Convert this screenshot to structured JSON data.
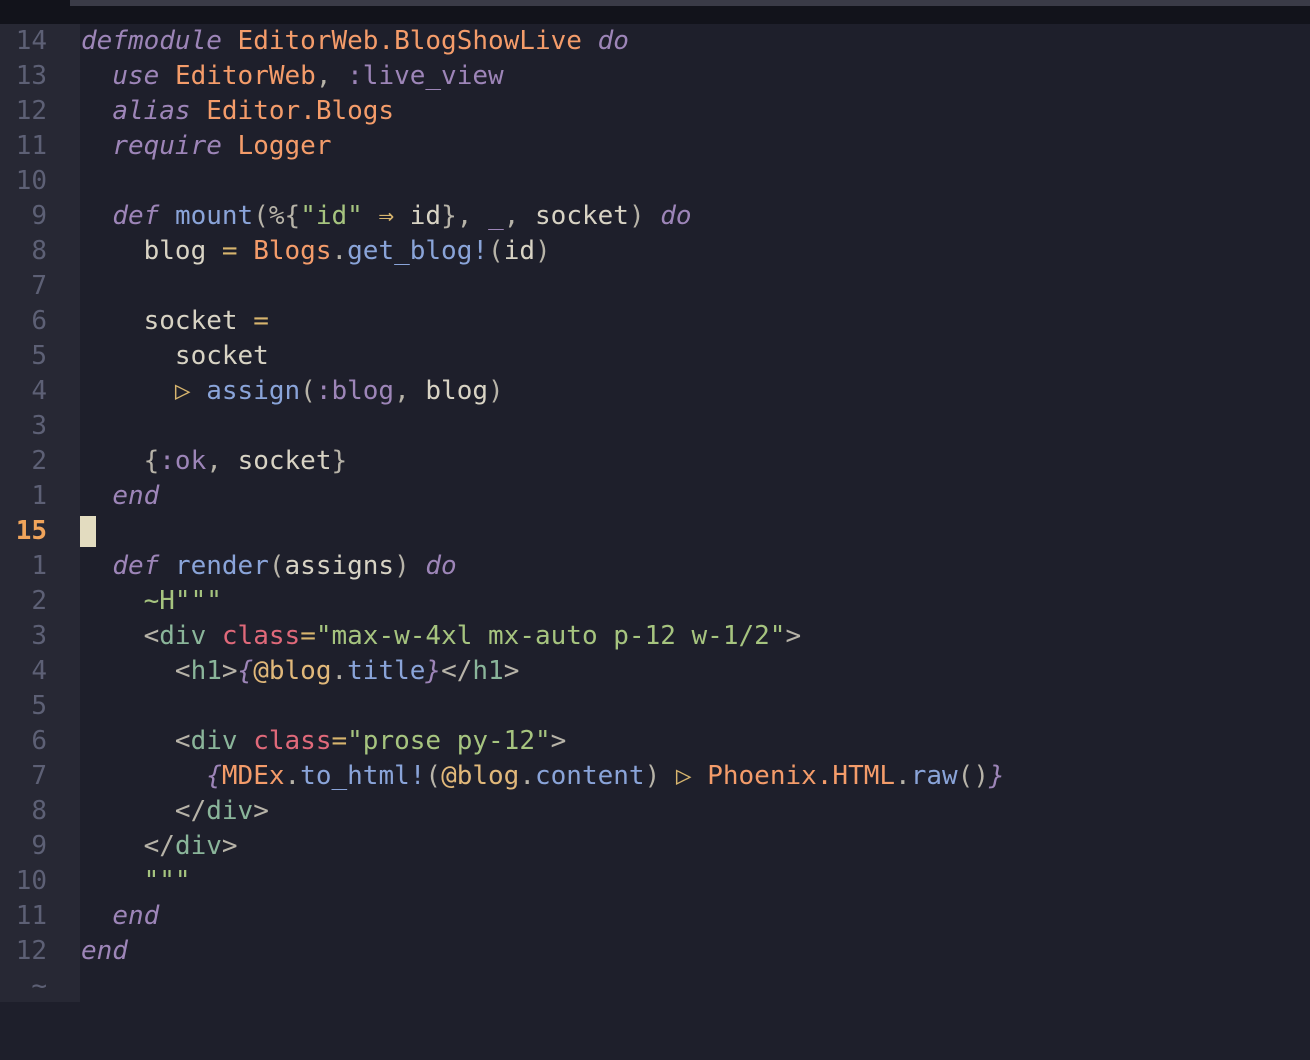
{
  "editor": {
    "lines": [
      {
        "n": "14",
        "tokens": [
          [
            "kw",
            "defmodule"
          ],
          [
            "var",
            " "
          ],
          [
            "mod",
            "EditorWeb.BlogShowLive"
          ],
          [
            "var",
            " "
          ],
          [
            "kw",
            "do"
          ]
        ]
      },
      {
        "n": "13",
        "tokens": [
          [
            "var",
            "  "
          ],
          [
            "kw",
            "use"
          ],
          [
            "var",
            " "
          ],
          [
            "mod",
            "EditorWeb"
          ],
          [
            "pun",
            ", "
          ],
          [
            "atom",
            ":live_view"
          ]
        ]
      },
      {
        "n": "12",
        "tokens": [
          [
            "var",
            "  "
          ],
          [
            "kw",
            "alias"
          ],
          [
            "var",
            " "
          ],
          [
            "mod",
            "Editor.Blogs"
          ]
        ]
      },
      {
        "n": "11",
        "tokens": [
          [
            "var",
            "  "
          ],
          [
            "kw",
            "require"
          ],
          [
            "var",
            " "
          ],
          [
            "mod",
            "Logger"
          ]
        ]
      },
      {
        "n": "10",
        "tokens": []
      },
      {
        "n": "9",
        "tokens": [
          [
            "var",
            "  "
          ],
          [
            "kw",
            "def"
          ],
          [
            "var",
            " "
          ],
          [
            "fn",
            "mount"
          ],
          [
            "pun",
            "(%{"
          ],
          [
            "str",
            "\"id\""
          ],
          [
            "var",
            " "
          ],
          [
            "op",
            "⇒"
          ],
          [
            "var",
            " id"
          ],
          [
            "pun",
            "}, "
          ],
          [
            "atom",
            "_"
          ],
          [
            "pun",
            ", "
          ],
          [
            "var",
            "socket"
          ],
          [
            "pun",
            ")"
          ],
          [
            "var",
            " "
          ],
          [
            "kw",
            "do"
          ]
        ]
      },
      {
        "n": "8",
        "tokens": [
          [
            "var",
            "    blog "
          ],
          [
            "op",
            "="
          ],
          [
            "var",
            " "
          ],
          [
            "mod",
            "Blogs"
          ],
          [
            "pun",
            "."
          ],
          [
            "fn",
            "get_blog!"
          ],
          [
            "pun",
            "("
          ],
          [
            "var",
            "id"
          ],
          [
            "pun",
            ")"
          ]
        ]
      },
      {
        "n": "7",
        "tokens": []
      },
      {
        "n": "6",
        "tokens": [
          [
            "var",
            "    socket "
          ],
          [
            "op",
            "="
          ]
        ]
      },
      {
        "n": "5",
        "tokens": [
          [
            "var",
            "      socket"
          ]
        ]
      },
      {
        "n": "4",
        "tokens": [
          [
            "var",
            "      "
          ],
          [
            "op",
            "▷"
          ],
          [
            "var",
            " "
          ],
          [
            "fn",
            "assign"
          ],
          [
            "pun",
            "("
          ],
          [
            "atom",
            ":blog"
          ],
          [
            "pun",
            ", "
          ],
          [
            "var",
            "blog"
          ],
          [
            "pun",
            ")"
          ]
        ]
      },
      {
        "n": "3",
        "tokens": []
      },
      {
        "n": "2",
        "tokens": [
          [
            "var",
            "    "
          ],
          [
            "pun",
            "{"
          ],
          [
            "atom",
            ":ok"
          ],
          [
            "pun",
            ", "
          ],
          [
            "var",
            "socket"
          ],
          [
            "pun",
            "}"
          ]
        ]
      },
      {
        "n": "1",
        "tokens": [
          [
            "var",
            "  "
          ],
          [
            "kw",
            "end"
          ]
        ]
      },
      {
        "n": "15",
        "current": true,
        "tokens": []
      },
      {
        "n": "1",
        "tokens": [
          [
            "var",
            "  "
          ],
          [
            "kw",
            "def"
          ],
          [
            "var",
            " "
          ],
          [
            "fn",
            "render"
          ],
          [
            "pun",
            "("
          ],
          [
            "var",
            "assigns"
          ],
          [
            "pun",
            ")"
          ],
          [
            "var",
            " "
          ],
          [
            "kw",
            "do"
          ]
        ]
      },
      {
        "n": "2",
        "tokens": [
          [
            "var",
            "    "
          ],
          [
            "str",
            "~H\"\"\""
          ]
        ]
      },
      {
        "n": "3",
        "tokens": [
          [
            "var",
            "    "
          ],
          [
            "pun",
            "<"
          ],
          [
            "tag",
            "div"
          ],
          [
            "var",
            " "
          ],
          [
            "attr",
            "class"
          ],
          [
            "op",
            "="
          ],
          [
            "str",
            "\"max-w-4xl mx-auto p-12 w-1/2\""
          ],
          [
            "pun",
            ">"
          ]
        ]
      },
      {
        "n": "4",
        "tokens": [
          [
            "var",
            "      "
          ],
          [
            "pun",
            "<"
          ],
          [
            "tag",
            "h1"
          ],
          [
            "pun",
            ">"
          ],
          [
            "interp",
            "{"
          ],
          [
            "att",
            "@blog"
          ],
          [
            "pun",
            "."
          ],
          [
            "fn",
            "title"
          ],
          [
            "interp",
            "}"
          ],
          [
            "pun",
            "</"
          ],
          [
            "tag",
            "h1"
          ],
          [
            "pun",
            ">"
          ]
        ]
      },
      {
        "n": "5",
        "tokens": []
      },
      {
        "n": "6",
        "tokens": [
          [
            "var",
            "      "
          ],
          [
            "pun",
            "<"
          ],
          [
            "tag",
            "div"
          ],
          [
            "var",
            " "
          ],
          [
            "attr",
            "class"
          ],
          [
            "op",
            "="
          ],
          [
            "str",
            "\"prose py-12\""
          ],
          [
            "pun",
            ">"
          ]
        ]
      },
      {
        "n": "7",
        "tokens": [
          [
            "var",
            "        "
          ],
          [
            "interp",
            "{"
          ],
          [
            "mod",
            "MDEx"
          ],
          [
            "pun",
            "."
          ],
          [
            "fn",
            "to_html!"
          ],
          [
            "pun",
            "("
          ],
          [
            "att",
            "@blog"
          ],
          [
            "pun",
            "."
          ],
          [
            "fn",
            "content"
          ],
          [
            "pun",
            ")"
          ],
          [
            "var",
            " "
          ],
          [
            "op",
            "▷"
          ],
          [
            "var",
            " "
          ],
          [
            "mod",
            "Phoenix.HTML"
          ],
          [
            "pun",
            "."
          ],
          [
            "fn",
            "raw"
          ],
          [
            "pun",
            "()"
          ],
          [
            "interp",
            "}"
          ]
        ]
      },
      {
        "n": "8",
        "tokens": [
          [
            "var",
            "      "
          ],
          [
            "pun",
            "</"
          ],
          [
            "tag",
            "div"
          ],
          [
            "pun",
            ">"
          ]
        ]
      },
      {
        "n": "9",
        "tokens": [
          [
            "var",
            "    "
          ],
          [
            "pun",
            "</"
          ],
          [
            "tag",
            "div"
          ],
          [
            "pun",
            ">"
          ]
        ]
      },
      {
        "n": "10",
        "tokens": [
          [
            "var",
            "    "
          ],
          [
            "str",
            "\"\"\""
          ]
        ]
      },
      {
        "n": "11",
        "tokens": [
          [
            "var",
            "  "
          ],
          [
            "kw",
            "end"
          ]
        ]
      },
      {
        "n": "12",
        "tokens": [
          [
            "kw",
            "end"
          ]
        ]
      },
      {
        "n": "~",
        "tilde": true,
        "tokens": []
      }
    ]
  }
}
